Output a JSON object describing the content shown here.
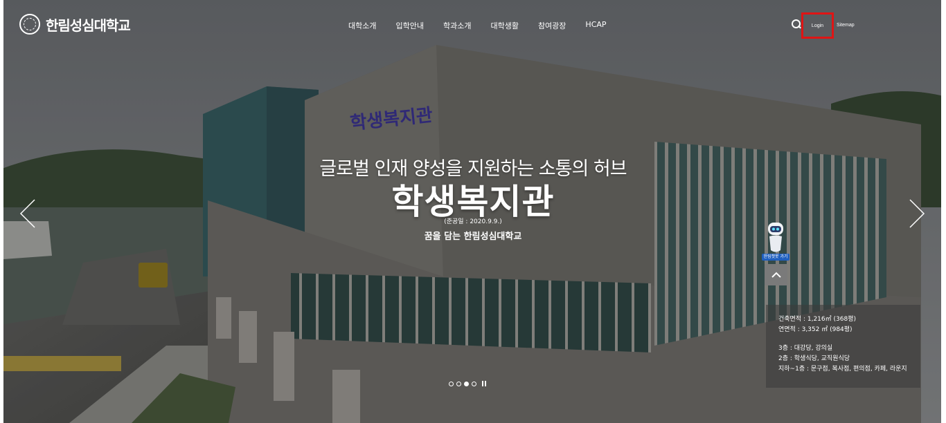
{
  "header": {
    "logo_text": "한림성심대학교",
    "nav": [
      "대학소개",
      "입학안내",
      "학과소개",
      "대학생활",
      "참여광장",
      "HCAP"
    ],
    "login_label": "Login",
    "sitemap_label": "Sitemap"
  },
  "hero": {
    "building_sign": "학생복지관",
    "headline": "글로벌 인재 양성을 지원하는 소통의 허브",
    "title": "학생복지관",
    "date": "(준공일 : 2020.9.9.)",
    "slogan": "꿈을 담는 한림성심대학교"
  },
  "chatbot": {
    "label": "한림챗봇 가기"
  },
  "info_panel": {
    "area": "건축면적 : 1,216㎡ (368평)",
    "floor_area": "연면적 : 3,352 ㎡ (984평)",
    "floor_3": "3층 : 대강당, 강의실",
    "floor_2": "2층 : 학생식당, 교직원식당",
    "floor_b1_1": "지하~1층 : 문구점, 복사점, 편의점, 카페, 라운지"
  },
  "pager": {
    "total": 4,
    "active_index": 2
  },
  "colors": {
    "highlight": "#e01414",
    "chatbot_label": "#1f5fbf"
  }
}
